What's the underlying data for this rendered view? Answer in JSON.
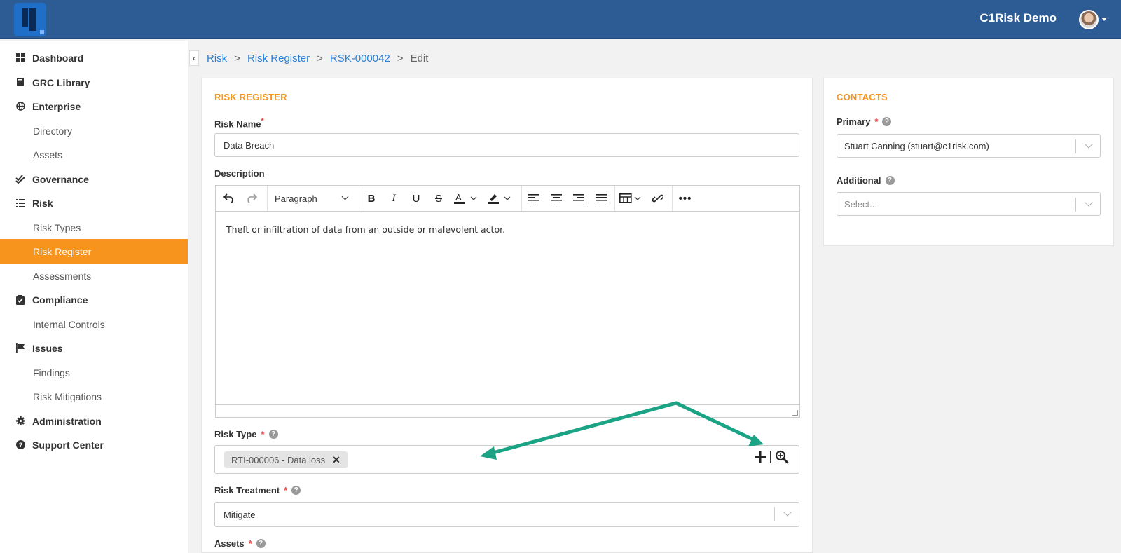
{
  "app": {
    "user_name": "C1Risk Demo"
  },
  "sidebar": {
    "items": [
      {
        "label": "Dashboard",
        "icon": "dashboard-icon",
        "level": "top"
      },
      {
        "label": "GRC Library",
        "icon": "book-icon",
        "level": "top"
      },
      {
        "label": "Enterprise",
        "icon": "globe-icon",
        "level": "top"
      },
      {
        "label": "Directory",
        "level": "sub"
      },
      {
        "label": "Assets",
        "level": "sub"
      },
      {
        "label": "Governance",
        "icon": "double-check-icon",
        "level": "top"
      },
      {
        "label": "Risk",
        "icon": "list-icon",
        "level": "top"
      },
      {
        "label": "Risk Types",
        "level": "sub"
      },
      {
        "label": "Risk Register",
        "level": "sub",
        "active": true
      },
      {
        "label": "Assessments",
        "level": "sub"
      },
      {
        "label": "Compliance",
        "icon": "clipboard-check-icon",
        "level": "top"
      },
      {
        "label": "Internal Controls",
        "level": "sub"
      },
      {
        "label": "Issues",
        "icon": "flag-icon",
        "level": "top"
      },
      {
        "label": "Findings",
        "level": "sub"
      },
      {
        "label": "Risk Mitigations",
        "level": "sub"
      },
      {
        "label": "Administration",
        "icon": "gear-icon",
        "level": "top"
      },
      {
        "label": "Support Center",
        "icon": "question-circle-icon",
        "level": "top"
      }
    ]
  },
  "breadcrumb": {
    "items": [
      "Risk",
      "Risk Register",
      "RSK-000042"
    ],
    "current": "Edit",
    "separator": ">"
  },
  "form": {
    "section_title": "RISK REGISTER",
    "risk_name": {
      "label": "Risk Name",
      "value": "Data Breach"
    },
    "description": {
      "label": "Description",
      "block_format": "Paragraph",
      "content": "Theft or infiltration of data from an outside or malevolent actor."
    },
    "risk_type": {
      "label": "Risk Type",
      "tag": "RTI-000006 - Data loss"
    },
    "risk_treatment": {
      "label": "Risk Treatment",
      "value": "Mitigate"
    },
    "assets": {
      "label": "Assets"
    }
  },
  "contacts": {
    "section_title": "CONTACTS",
    "primary": {
      "label": "Primary",
      "value": "Stuart Canning (stuart@c1risk.com)"
    },
    "additional": {
      "label": "Additional",
      "placeholder": "Select..."
    }
  },
  "colors": {
    "topbar": "#2d5b93",
    "accent": "#f7941d",
    "link": "#2a7fd4",
    "annotation_arrow": "#1aa384"
  }
}
